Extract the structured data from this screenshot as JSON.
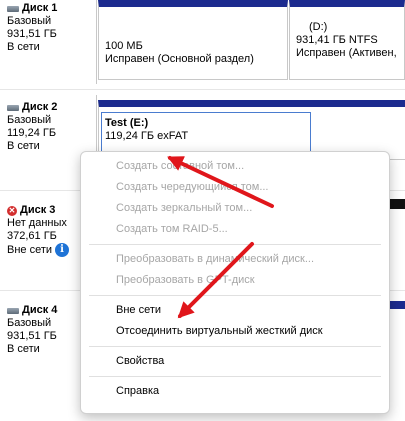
{
  "disks": [
    {
      "name": "Диск 1",
      "type": "Базовый",
      "size": "931,51 ГБ",
      "status": "В сети",
      "icon": "hdd-icon"
    },
    {
      "name": "Диск 2",
      "type": "Базовый",
      "size": "119,24 ГБ",
      "status": "В сети",
      "icon": "hdd-icon"
    },
    {
      "name": "Диск 3",
      "type": "Нет данных",
      "size": "372,61 ГБ",
      "status": "Вне сети",
      "icon": "offline-disk-icon",
      "status_icon": "info-icon"
    },
    {
      "name": "Диск 4",
      "type": "Базовый",
      "size": "931,51 ГБ",
      "status": "В сети",
      "icon": "hdd-icon"
    }
  ],
  "disk1_partitions": [
    {
      "title": "",
      "size": "100 МБ",
      "status": "Исправен (Основной раздел)"
    },
    {
      "title": "(D:)",
      "size": "931,41 ГБ NTFS",
      "status": "Исправен (Активен,"
    }
  ],
  "selected_volume": {
    "title": "Test  (E:)",
    "size": "119,24 ГБ exFAT"
  },
  "context_menu": {
    "group1": [
      {
        "label": "Создать составной том...",
        "disabled": true
      },
      {
        "label": "Создать чередующийся том...",
        "disabled": true
      },
      {
        "label": "Создать зеркальный том...",
        "disabled": true
      },
      {
        "label": "Создать том RAID-5...",
        "disabled": true
      }
    ],
    "group2": [
      {
        "label": "Преобразовать в динамический диск...",
        "disabled": true
      },
      {
        "label": "Преобразовать в GPT-диск",
        "disabled": true
      }
    ],
    "group3": [
      {
        "label": "Вне сети",
        "disabled": false
      },
      {
        "label": "Отсоединить виртуальный жесткий диск",
        "disabled": false
      }
    ],
    "group4": [
      {
        "label": "Свойства",
        "disabled": false
      }
    ],
    "group5": [
      {
        "label": "Справка",
        "disabled": false
      }
    ]
  },
  "colors": {
    "volume_bar": "#1c2b8f",
    "annotation_arrow": "#e0161b",
    "disabled_text": "#a6a6a6"
  }
}
